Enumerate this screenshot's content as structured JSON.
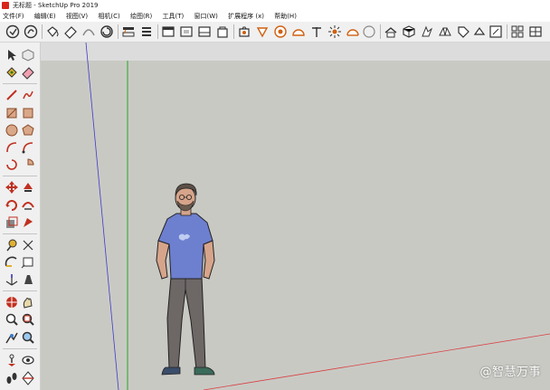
{
  "window": {
    "title": "无标题 - SketchUp Pro 2019"
  },
  "menu": [
    "文件(F)",
    "编辑(E)",
    "视图(V)",
    "相机(C)",
    "绘图(R)",
    "工具(T)",
    "窗口(W)",
    "扩展程序 (x)",
    "帮助(H)"
  ],
  "colors": {
    "axis_red": "#d94040",
    "axis_green": "#3fae3f",
    "axis_blue": "#3c3cc8",
    "sky": "#dcdcdc",
    "ground": "#c9c9c4"
  },
  "watermark": "@智慧万事"
}
